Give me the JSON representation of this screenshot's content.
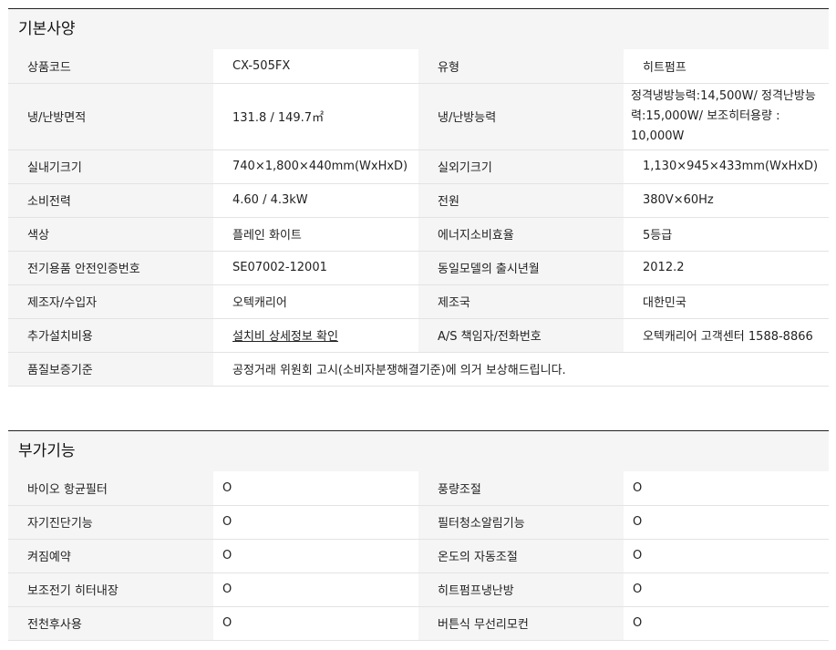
{
  "basic": {
    "title": "기본사양",
    "rows": [
      [
        "상품코드",
        "CX-505FX",
        "유형",
        "히트펌프"
      ],
      [
        "냉/난방면적",
        "131.8 / 149.7㎡",
        "냉/난방능력",
        "정격냉방능력:14,500W/ 정격난방능력:15,000W/ 보조히터용량 : 10,000W"
      ],
      [
        "실내기크기",
        "740×1,800×440mm(WxHxD)",
        "실외기크기",
        "1,130×945×433mm(WxHxD)"
      ],
      [
        "소비전력",
        "4.60 / 4.3kW",
        "전원",
        "380V×60Hz"
      ],
      [
        "색상",
        "플레인 화이트",
        "에너지소비효율",
        "5등급"
      ],
      [
        "전기용품 안전인증번호",
        "SE07002-12001",
        "동일모델의 출시년월",
        "2012.2"
      ],
      [
        "제조자/수입자",
        "오텍캐리어",
        "제조국",
        "대한민국"
      ],
      [
        "추가설치비용",
        "설치비 상세정보 확인",
        "A/S 책임자/전화번호",
        "오텍캐리어 고객센터 1588-8866"
      ]
    ],
    "quality": {
      "label": "품질보증기준",
      "value": "공정거래 위원회 고시(소비자분쟁해결기준)에 의거 보상해드립니다."
    }
  },
  "extra": {
    "title": "부가기능",
    "rows": [
      [
        "바이오 항균필터",
        "O",
        "풍량조절",
        "O"
      ],
      [
        "자기진단기능",
        "O",
        "필터청소알림기능",
        "O"
      ],
      [
        "켜짐예약",
        "O",
        "온도의 자동조절",
        "O"
      ],
      [
        "보조전기 히터내장",
        "O",
        "히트펌프냉난방",
        "O"
      ],
      [
        "전천후사용",
        "O",
        "버튼식 무선리모컨",
        "O"
      ]
    ]
  }
}
